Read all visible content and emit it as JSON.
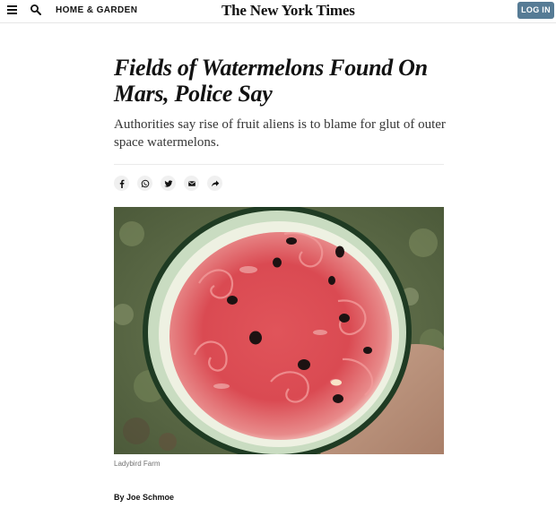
{
  "header": {
    "menu_icon": "hamburger-menu-icon",
    "search_icon": "search-icon",
    "section_label": "HOME & GARDEN",
    "masthead": "The New York Times",
    "login_label": "LOG IN",
    "login_color": "#567b95"
  },
  "article": {
    "headline": "Fields of Watermelons Found On Mars, Police Say",
    "summary": "Authorities say rise of fruit aliens is to blame for glut of outer space watermelons.",
    "share_icons": [
      "facebook-icon",
      "whatsapp-icon",
      "twitter-icon",
      "email-icon",
      "share-arrow-icon"
    ],
    "photo_caption": "Ladybird Farm",
    "byline_prefix": "By",
    "byline_author": "Joe Schmoe"
  }
}
